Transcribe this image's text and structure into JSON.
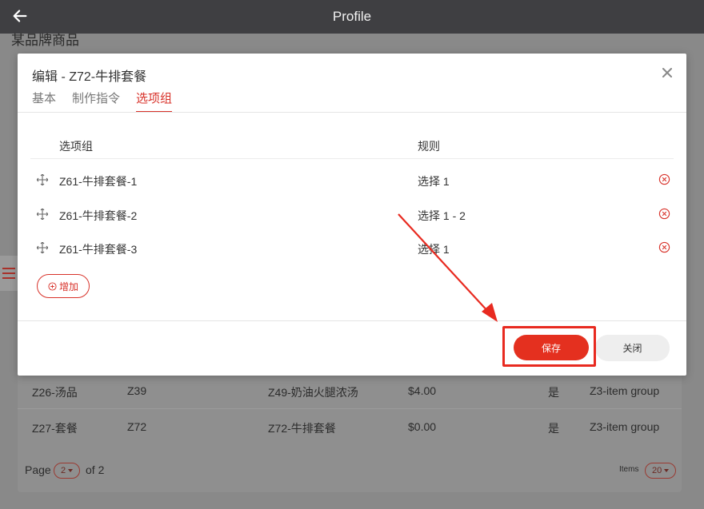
{
  "appbar": {
    "title": "Profile",
    "back_icon": "arrow-left-icon"
  },
  "background": {
    "heading": "某品牌商品",
    "rows": [
      {
        "c1": "Z26-汤品",
        "c2": "Z39",
        "c3": "Z49-奶油火腿浓汤",
        "c4": "$4.00",
        "c5": "是",
        "c6": "Z3-item group"
      },
      {
        "c1": "Z27-套餐",
        "c2": "Z72",
        "c3": "Z72-牛排套餐",
        "c4": "$0.00",
        "c5": "是",
        "c6": "Z3-item group"
      }
    ],
    "pager": {
      "page_label": "Page",
      "page_value": "2",
      "of_label": "of 2",
      "items_label": "Items",
      "items_value": "20"
    }
  },
  "modal": {
    "title": "编辑 - Z72-牛排套餐",
    "tabs": [
      {
        "label": "基本",
        "active": false
      },
      {
        "label": "制作指令",
        "active": false
      },
      {
        "label": "选项组",
        "active": true
      }
    ],
    "columns": {
      "group": "选项组",
      "rule": "规则"
    },
    "rows": [
      {
        "name": "Z61-牛排套餐-1",
        "rule": "选择 1"
      },
      {
        "name": "Z61-牛排套餐-2",
        "rule": "选择 1 - 2"
      },
      {
        "name": "Z61-牛排套餐-3",
        "rule": "选择 1"
      }
    ],
    "add_label": "增加",
    "save_label": "保存",
    "close_label": "关闭"
  },
  "colors": {
    "accent": "#d8322a",
    "save": "#e4301f",
    "appbar": "#3f3f42"
  }
}
